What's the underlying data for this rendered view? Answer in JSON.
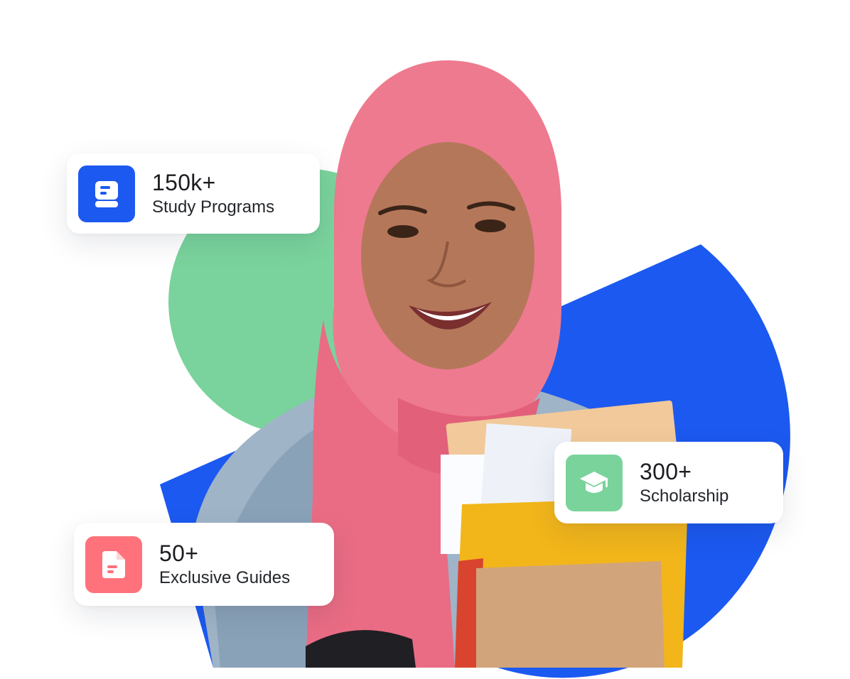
{
  "colors": {
    "green_shape": "#7ad39c",
    "blue_shape": "#1c59f0",
    "programs_icon_bg": "#1c59f0",
    "scholarship_icon_bg": "#79d39b",
    "guides_icon_bg": "#ff727b",
    "hijab": "#ee7a8f",
    "jacket": "#9fb4c7"
  },
  "stats": [
    {
      "value": "150k+",
      "label": "Study Programs",
      "icon": "book-icon"
    },
    {
      "value": "300+",
      "label": "Scholarship",
      "icon": "graduation-cap-icon"
    },
    {
      "value": "50+",
      "label": "Exclusive Guides",
      "icon": "document-icon"
    }
  ],
  "illustration": {
    "subject": "student-with-books"
  }
}
